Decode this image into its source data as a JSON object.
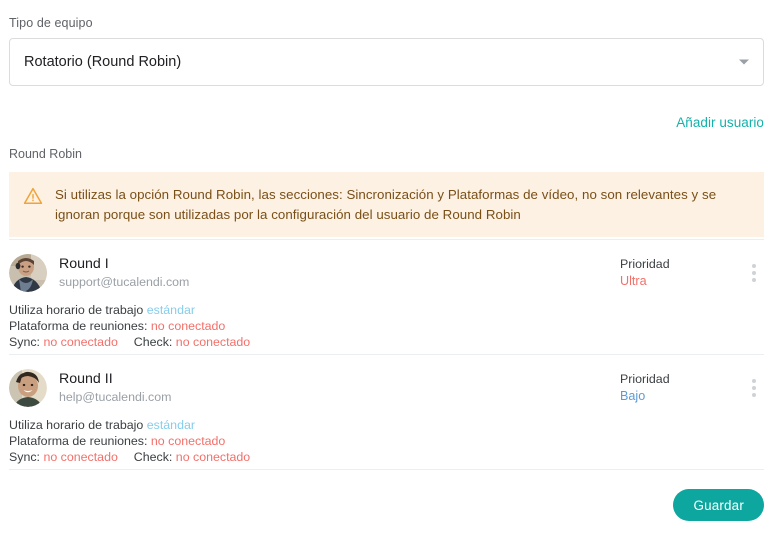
{
  "form": {
    "team_type_label": "Tipo de equipo",
    "team_type_value": "Rotatorio (Round Robin)",
    "dropdown_icon": "chevron-down-icon"
  },
  "actions": {
    "add_user_label": "Añadir usuario",
    "save_label": "Guardar"
  },
  "section": {
    "round_robin_label": "Round Robin"
  },
  "warning": {
    "icon": "warning-triangle-icon",
    "text": "Si utilizas la opción Round Robin, las secciones: Sincronización y Plataformas de vídeo, no son relevantes y se ignoran porque son utilizadas por la configuración del usuario de Round Robin"
  },
  "users": [
    {
      "name": "Round I",
      "email": "support@tucalendi.com",
      "avatar": "user-photo-avatar",
      "priority_label": "Prioridad",
      "priority_value": "Ultra",
      "priority_color": "#f3706a",
      "schedule_prefix": "Utiliza horario de trabajo",
      "schedule_value": "estándar",
      "platform_prefix": "Plataforma de reuniones:",
      "platform_value": "no conectado",
      "sync_prefix": "Sync:",
      "sync_value": "no conectado",
      "check_prefix": "Check:",
      "check_value": "no conectado",
      "menu_icon": "kebab-menu-icon"
    },
    {
      "name": "Round II",
      "email": "help@tucalendi.com",
      "avatar": "user-photo-avatar",
      "priority_label": "Prioridad",
      "priority_value": "Bajo",
      "priority_color": "#5b9bd5",
      "schedule_prefix": "Utiliza horario de trabajo",
      "schedule_value": "estándar",
      "platform_prefix": "Plataforma de reuniones:",
      "platform_value": "no conectado",
      "sync_prefix": "Sync:",
      "sync_value": "no conectado",
      "check_prefix": "Check:",
      "check_value": "no conectado",
      "menu_icon": "kebab-menu-icon"
    }
  ],
  "colors": {
    "accent_teal": "#0ea79f",
    "link_teal": "#14b1ab",
    "warning_bg": "#fdf1e3",
    "warning_text": "#7a4f17",
    "warning_icon": "#f0a339",
    "danger": "#f3706a",
    "info_blue": "#87cdeb"
  }
}
